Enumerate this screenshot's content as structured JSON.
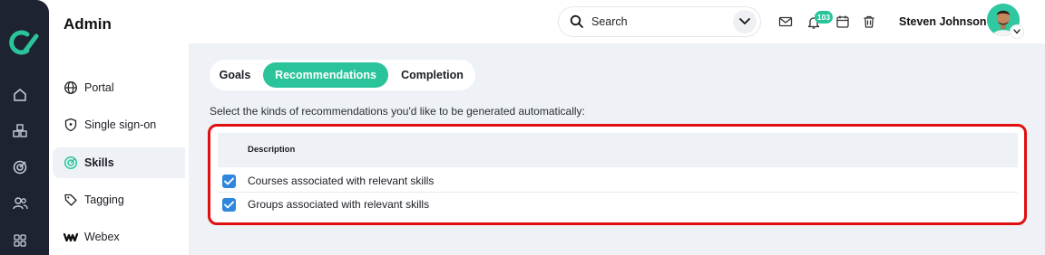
{
  "app": {
    "title": "Admin"
  },
  "header": {
    "search": {
      "placeholder": "Search"
    },
    "notifications_badge": "103",
    "user_name": "Steven Johnson"
  },
  "rail": {
    "icons": [
      "logo-icon",
      "home-icon",
      "cubes-icon",
      "target-icon",
      "users-icon",
      "apps-grid-icon"
    ]
  },
  "settings_nav": {
    "items": [
      {
        "label": "Portal",
        "icon": "globe-icon"
      },
      {
        "label": "Single sign-on",
        "icon": "shield-icon"
      },
      {
        "label": "Skills",
        "icon": "skills-icon",
        "active": true
      },
      {
        "label": "Tagging",
        "icon": "tag-icon"
      },
      {
        "label": "Webex",
        "icon": "webex-icon"
      }
    ]
  },
  "tabs": [
    {
      "label": "Goals"
    },
    {
      "label": "Recommendations",
      "active": true
    },
    {
      "label": "Completion"
    }
  ],
  "main": {
    "instructions": "Select the kinds of recommendations you'd like to be generated automatically:",
    "table": {
      "column_header": "Description",
      "rows": [
        {
          "label": "Courses associated with relevant skills",
          "checked": true
        },
        {
          "label": "Groups associated with relevant skills",
          "checked": true
        }
      ]
    }
  },
  "colors": {
    "accent": "#2bc49a",
    "rail": "#1d2331",
    "checkbox": "#2f86dd",
    "highlight_outline": "#e01010"
  }
}
